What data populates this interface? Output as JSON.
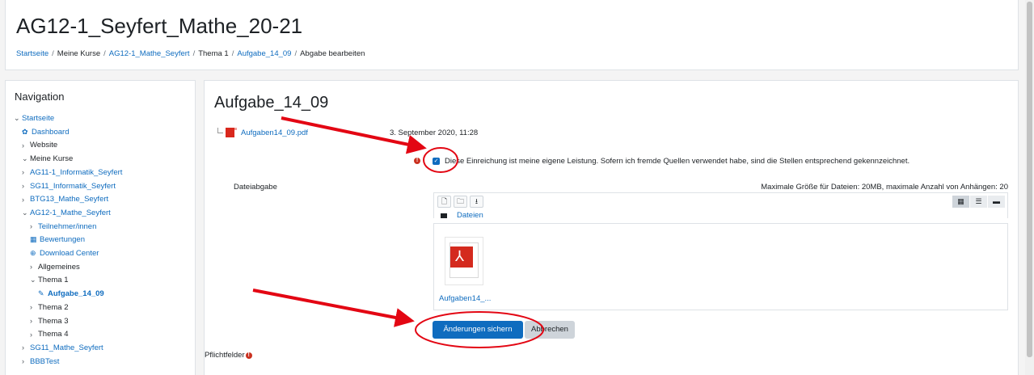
{
  "course": {
    "title": "AG12-1_Seyfert_Mathe_20-21"
  },
  "breadcrumb": [
    {
      "label": "Startseite",
      "link": true
    },
    {
      "label": "Meine Kurse",
      "link": false
    },
    {
      "label": "AG12-1_Mathe_Seyfert",
      "link": true
    },
    {
      "label": "Thema 1",
      "link": false
    },
    {
      "label": "Aufgabe_14_09",
      "link": true
    },
    {
      "label": "Abgabe bearbeiten",
      "link": false
    }
  ],
  "nav": {
    "title": "Navigation",
    "items": [
      {
        "label": "Startseite",
        "caret": "⌄",
        "icon": "",
        "link": true,
        "indent": 0
      },
      {
        "label": "Dashboard",
        "caret": "",
        "icon": "dashboard-icon",
        "link": true,
        "indent": 1
      },
      {
        "label": "Website",
        "caret": "›",
        "icon": "",
        "link": false,
        "indent": 1
      },
      {
        "label": "Meine Kurse",
        "caret": "⌄",
        "icon": "",
        "link": false,
        "indent": 1
      },
      {
        "label": "AG11-1_Informatik_Seyfert",
        "caret": "›",
        "icon": "",
        "link": true,
        "indent": 1
      },
      {
        "label": "SG11_Informatik_Seyfert",
        "caret": "›",
        "icon": "",
        "link": true,
        "indent": 1
      },
      {
        "label": "BTG13_Mathe_Seyfert",
        "caret": "›",
        "icon": "",
        "link": true,
        "indent": 1
      },
      {
        "label": "AG12-1_Mathe_Seyfert",
        "caret": "⌄",
        "icon": "",
        "link": true,
        "indent": 1
      },
      {
        "label": "Teilnehmer/innen",
        "caret": "›",
        "icon": "",
        "link": true,
        "indent": 2
      },
      {
        "label": "Bewertungen",
        "caret": "",
        "icon": "table-icon",
        "link": true,
        "indent": 2
      },
      {
        "label": "Download Center",
        "caret": "",
        "icon": "download-icon",
        "link": true,
        "indent": 2
      },
      {
        "label": "Allgemeines",
        "caret": "›",
        "icon": "",
        "link": false,
        "indent": 2
      },
      {
        "label": "Thema 1",
        "caret": "⌄",
        "icon": "",
        "link": false,
        "indent": 2
      },
      {
        "label": "Aufgabe_14_09",
        "caret": "",
        "icon": "assignment-icon",
        "link": true,
        "indent": 3,
        "active": true
      },
      {
        "label": "Thema 2",
        "caret": "›",
        "icon": "",
        "link": false,
        "indent": 2
      },
      {
        "label": "Thema 3",
        "caret": "›",
        "icon": "",
        "link": false,
        "indent": 2
      },
      {
        "label": "Thema 4",
        "caret": "›",
        "icon": "",
        "link": false,
        "indent": 2
      },
      {
        "label": "SG11_Mathe_Seyfert",
        "caret": "›",
        "icon": "",
        "link": true,
        "indent": 1
      },
      {
        "label": "BBBTest",
        "caret": "›",
        "icon": "",
        "link": true,
        "indent": 1
      }
    ]
  },
  "assignment": {
    "title": "Aufgabe_14_09",
    "attachment": "Aufgaben14_09.pdf",
    "date": "3. September 2020, 11:28",
    "declaration": "Diese Einreichung ist meine eigene Leistung. Sofern ich fremde Quellen verwendet habe, sind die Stellen entsprechend gekennzeichnet.",
    "declaration_checked": true,
    "file_submission_label": "Dateiabgabe",
    "max_size": "Maximale Größe für Dateien: 20MB, maximale Anzahl von Anhängen: 20",
    "folder": "Dateien",
    "file_tile_name": "Aufgaben14_...",
    "save_label": "Änderungen sichern",
    "cancel_label": "Abbrechen",
    "required_label": "Pflichtfelder"
  },
  "colors": {
    "link": "#0f6cbf",
    "primary": "#0f6cbf",
    "danger": "#ca3120",
    "annotation": "#e30613"
  }
}
